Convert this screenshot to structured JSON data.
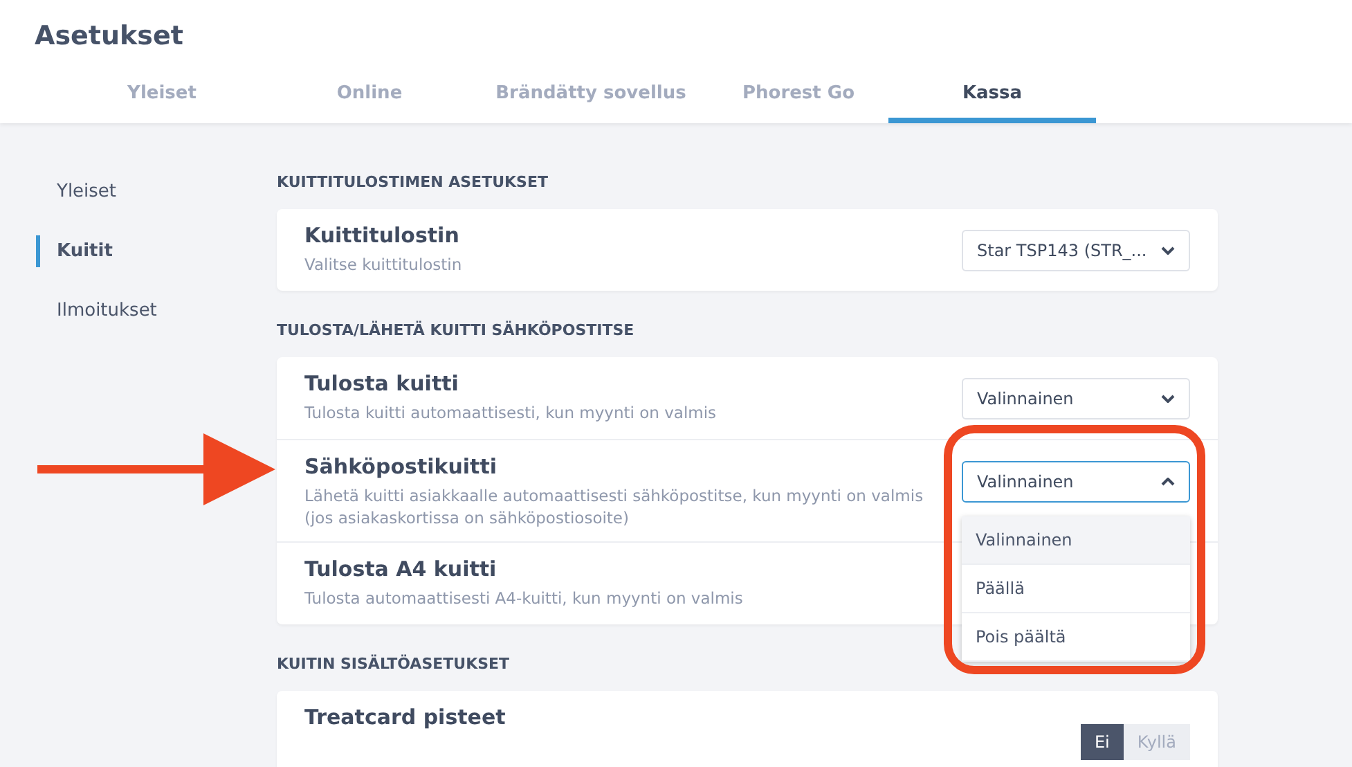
{
  "header": {
    "title": "Asetukset"
  },
  "tabs": [
    {
      "label": "Yleiset",
      "selected": false
    },
    {
      "label": "Online",
      "selected": false
    },
    {
      "label": "Brändätty sovellus",
      "selected": false
    },
    {
      "label": "Phorest Go",
      "selected": false
    },
    {
      "label": "Kassa",
      "selected": true
    }
  ],
  "sidebar": {
    "items": [
      {
        "label": "Yleiset",
        "selected": false
      },
      {
        "label": "Kuitit",
        "selected": true
      },
      {
        "label": "Ilmoitukset",
        "selected": false
      }
    ]
  },
  "sections": [
    {
      "heading": "KUITTITULOSTIMEN ASETUKSET",
      "rows": [
        {
          "kind": "select",
          "title": "Kuittitulostin",
          "description": "Valitse kuittitulostin",
          "value": "Star TSP143 (STR_...",
          "expanded": false
        }
      ]
    },
    {
      "heading": "TULOSTA/LÄHETÄ KUITTI SÄHKÖPOSTITSE",
      "rows": [
        {
          "kind": "select",
          "title": "Tulosta kuitti",
          "description": "Tulosta kuitti automaattisesti, kun myynti on valmis",
          "value": "Valinnainen",
          "expanded": false
        },
        {
          "kind": "select",
          "title": "Sähköpostikuitti",
          "description": "Lähetä kuitti asiakkaalle automaattisesti sähköpostitse, kun myynti on valmis (jos asiakaskortissa on sähköpostiosoite)",
          "value": "Valinnainen",
          "expanded": true,
          "options": [
            {
              "label": "Valinnainen",
              "selected": true
            },
            {
              "label": "Päällä",
              "selected": false
            },
            {
              "label": "Pois päältä",
              "selected": false
            }
          ]
        },
        {
          "kind": "hidden",
          "title": "Tulosta A4 kuitti",
          "description": "Tulosta automaattisesti A4-kuitti, kun myynti on valmis"
        }
      ]
    },
    {
      "heading": "KUITIN SISÄLTÖASETUKSET",
      "rows": [
        {
          "kind": "toggle",
          "title": "Treatcard pisteet",
          "options": [
            {
              "label": "Ei",
              "selected": true
            },
            {
              "label": "Kyllä",
              "selected": false
            }
          ]
        }
      ]
    }
  ]
}
